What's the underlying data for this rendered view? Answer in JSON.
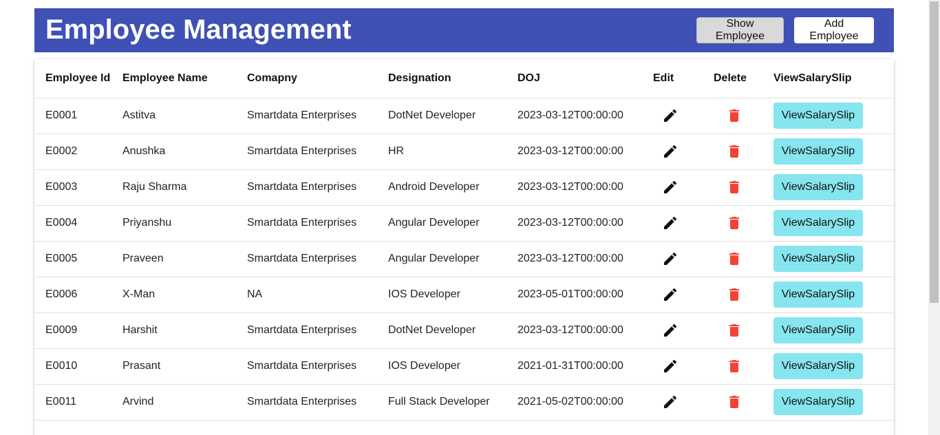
{
  "header": {
    "title": "Employee Management",
    "show_label": "Show Employee",
    "add_label": "Add Employee",
    "bg_color": "#3f51b5"
  },
  "table": {
    "columns": [
      "Employee Id",
      "Employee Name",
      "Comapny",
      "Designation",
      "DOJ",
      "Edit",
      "Delete",
      "ViewSalarySlip"
    ],
    "view_label": "ViewSalarySlip",
    "rows": [
      {
        "id": "E0001",
        "name": "Astitva",
        "company": "Smartdata Enterprises",
        "designation": "DotNet Developer",
        "doj": "2023-03-12T00:00:00"
      },
      {
        "id": "E0002",
        "name": "Anushka",
        "company": "Smartdata Enterprises",
        "designation": "HR",
        "doj": "2023-03-12T00:00:00"
      },
      {
        "id": "E0003",
        "name": "Raju Sharma",
        "company": "Smartdata Enterprises",
        "designation": "Android Developer",
        "doj": "2023-03-12T00:00:00"
      },
      {
        "id": "E0004",
        "name": "Priyanshu",
        "company": "Smartdata Enterprises",
        "designation": "Angular Developer",
        "doj": "2023-03-12T00:00:00"
      },
      {
        "id": "E0005",
        "name": "Praveen",
        "company": "Smartdata Enterprises",
        "designation": "Angular Developer",
        "doj": "2023-03-12T00:00:00"
      },
      {
        "id": "E0006",
        "name": "X-Man",
        "company": "NA",
        "designation": "IOS Developer",
        "doj": "2023-05-01T00:00:00"
      },
      {
        "id": "E0009",
        "name": "Harshit",
        "company": "Smartdata Enterprises",
        "designation": "DotNet Developer",
        "doj": "2023-03-12T00:00:00"
      },
      {
        "id": "E0010",
        "name": "Prasant",
        "company": "Smartdata Enterprises",
        "designation": "IOS Developer",
        "doj": "2021-01-31T00:00:00"
      },
      {
        "id": "E0011",
        "name": "Arvind",
        "company": "Smartdata Enterprises",
        "designation": "Full Stack Developer",
        "doj": "2021-05-02T00:00:00"
      }
    ],
    "icons": {
      "edit": "pencil-icon",
      "delete": "trash-icon"
    },
    "colors": {
      "delete": "#f44336",
      "view_button": "#86e5ee"
    }
  }
}
